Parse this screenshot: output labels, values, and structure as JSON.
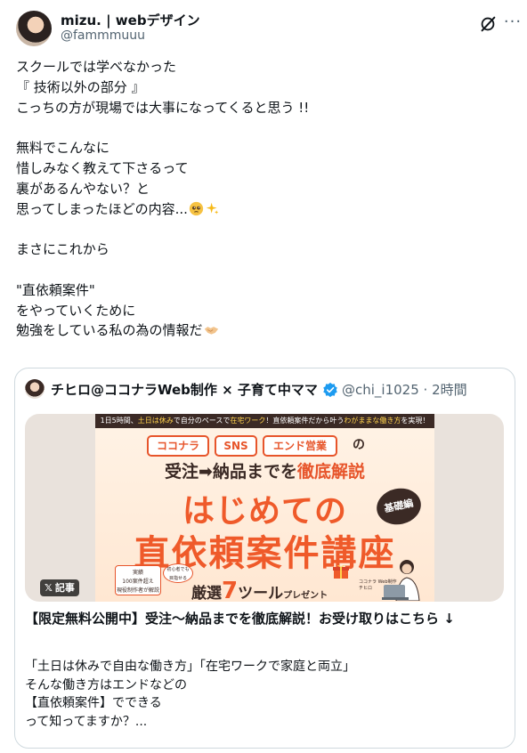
{
  "post": {
    "display_name": "mizu. | webデザイン",
    "handle": "@fammmuuu",
    "more_label": "···",
    "lines": [
      "スクールでは学べなかった",
      "『 技術以外の部分 』",
      "こっちの方が現場では大事になってくると思う !!",
      "",
      "無料でこんなに",
      "惜しみなく教えて下さるって",
      "裏があるんやない？と",
      "思ってしまったほどの内容...",
      "",
      "まさにこれから",
      "",
      "\"直依頼案件\"",
      "をやっていくために",
      "勉強をしている私の為の情報だ"
    ]
  },
  "quote": {
    "name": "チヒロ@ココナラWeb制作 × 子育て中ママ",
    "handle_time": "@chi_i1025 · 2時間",
    "article_pill": "記事",
    "article_pill_x": "𝕏",
    "image": {
      "top_strip_a": "1日5時間、",
      "top_strip_b": "土日は休み",
      "top_strip_c": "で自分のペースで",
      "top_strip_d": "在宅ワーク",
      "top_strip_e": "！直依頼案件だから叶う",
      "top_strip_f": "わがままな働き方",
      "top_strip_g": "を実現！",
      "chips": [
        "ココナラ",
        "SNS",
        "エンド営業"
      ],
      "chip_no": "の",
      "subtitle_a": "受注➡納品までを",
      "subtitle_b": "徹底解説",
      "title1": "はじめての",
      "badge": "基礎編",
      "title2": "直依頼案件講座",
      "achievement": "実績\n100案件超え\n現役制作者が解説",
      "bubble": "初心者でも\n目指せる",
      "present_a": "厳選",
      "present_seven": "7",
      "present_b": "ツール",
      "present_c": "プレゼント",
      "pc_label": "ココナラ Web制作\nチヒロ"
    },
    "article_title": "【限定無料公開中】受注〜納品までを徹底解説！お受け取りはこちら ↓",
    "article_body": [
      "「土日は休みで自由な働き方」「在宅ワークで家庭と両立」",
      "そんな働き方はエンドなどの",
      "【直依頼案件】でできる",
      "って知ってますか？..."
    ]
  },
  "colors": {
    "accent": "#ef5a2a",
    "brand_dark": "#3b2a25",
    "verified": "#1d9bf0",
    "muted": "#536471"
  }
}
